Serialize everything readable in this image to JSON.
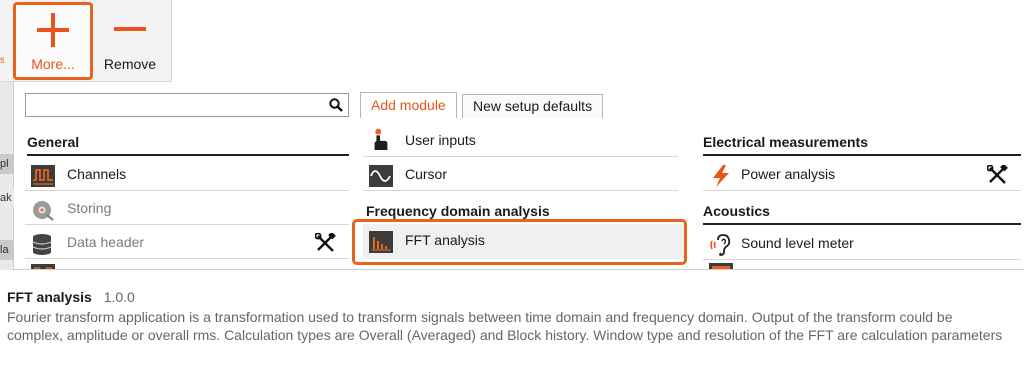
{
  "ribbon": {
    "more_label": "More...",
    "remove_label": "Remove",
    "left_edge_text": "s"
  },
  "left_strip": {
    "labels": [
      "pl",
      "ak",
      "la"
    ]
  },
  "search": {
    "value": "",
    "placeholder": ""
  },
  "tabs": [
    {
      "label": "Add module",
      "active": true
    },
    {
      "label": "New setup defaults",
      "active": false
    }
  ],
  "columns": {
    "general": {
      "heading": "General",
      "items": [
        {
          "label": "Channels",
          "icon": "channels-icon",
          "enabled": true
        },
        {
          "label": "Storing",
          "icon": "storing-icon",
          "enabled": false
        },
        {
          "label": "Data header",
          "icon": "database-icon",
          "enabled": false,
          "tools": true
        }
      ]
    },
    "middle": {
      "items_top": [
        {
          "label": "User inputs",
          "icon": "user-input-icon"
        },
        {
          "label": "Cursor",
          "icon": "cursor-wave-icon"
        }
      ],
      "heading": "Frequency domain analysis",
      "items": [
        {
          "label": "FFT analysis",
          "icon": "fft-icon",
          "selected": true
        }
      ]
    },
    "right": {
      "heading_1": "Electrical measurements",
      "items_1": [
        {
          "label": "Power analysis",
          "icon": "lightning-icon",
          "tools": true
        }
      ],
      "heading_2": "Acoustics",
      "items_2": [
        {
          "label": "Sound level meter",
          "icon": "ear-sound-icon"
        }
      ]
    }
  },
  "description": {
    "title": "FFT analysis",
    "version": "1.0.0",
    "text": "Fourier transform application is a transformation used to transform signals between time domain and frequency domain. Output of the transform could be complex, amplitude or overall rms. Calculation types are Overall (Averaged) and Block history. Window type and resolution of the FFT are calculation parameters"
  },
  "colors": {
    "accent": "#e8631d",
    "heading_rule": "#222222",
    "dim_text": "#7a7a7a"
  }
}
